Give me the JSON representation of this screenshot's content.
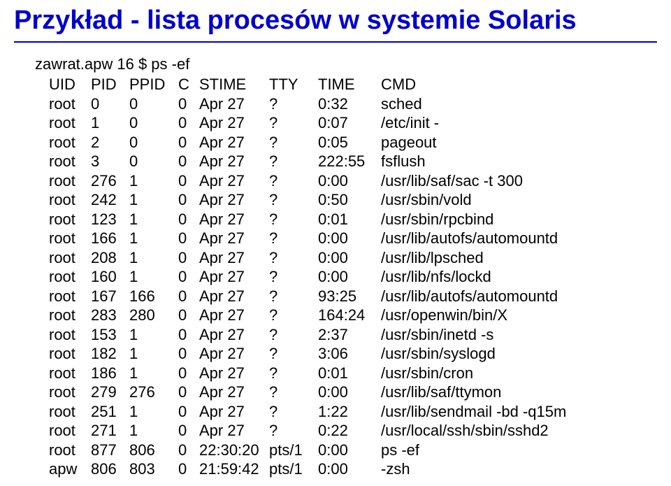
{
  "title": "Przykład - lista procesów w systemie Solaris",
  "prompt": "zawrat.apw 16 $ ps -ef",
  "headers": {
    "uid": "UID",
    "pid": "PID",
    "ppid": "PPID",
    "c": "C",
    "stime": "STIME",
    "tty": "TTY",
    "time": "TIME",
    "cmd": "CMD"
  },
  "rows": [
    {
      "uid": "root",
      "pid": "0",
      "ppid": "0",
      "c": "0",
      "stime": "Apr 27",
      "tty": "?",
      "time": "0:32",
      "cmd": "sched"
    },
    {
      "uid": "root",
      "pid": "1",
      "ppid": "0",
      "c": "0",
      "stime": "Apr 27",
      "tty": "?",
      "time": "0:07",
      "cmd": "/etc/init -"
    },
    {
      "uid": "root",
      "pid": "2",
      "ppid": "0",
      "c": "0",
      "stime": "Apr 27",
      "tty": "?",
      "time": "0:05",
      "cmd": "pageout"
    },
    {
      "uid": "root",
      "pid": "3",
      "ppid": "0",
      "c": "0",
      "stime": "Apr 27",
      "tty": "?",
      "time": "222:55",
      "cmd": "fsflush"
    },
    {
      "uid": "root",
      "pid": "276",
      "ppid": "1",
      "c": "0",
      "stime": "Apr 27",
      "tty": "?",
      "time": "0:00",
      "cmd": "/usr/lib/saf/sac -t 300"
    },
    {
      "uid": "root",
      "pid": "242",
      "ppid": "1",
      "c": "0",
      "stime": "Apr 27",
      "tty": "?",
      "time": "0:50",
      "cmd": "/usr/sbin/vold"
    },
    {
      "uid": "root",
      "pid": "123",
      "ppid": "1",
      "c": "0",
      "stime": "Apr 27",
      "tty": "?",
      "time": "0:01",
      "cmd": "/usr/sbin/rpcbind"
    },
    {
      "uid": "root",
      "pid": "166",
      "ppid": "1",
      "c": "0",
      "stime": "Apr 27",
      "tty": "?",
      "time": "0:00",
      "cmd": "/usr/lib/autofs/automountd"
    },
    {
      "uid": "root",
      "pid": "208",
      "ppid": "1",
      "c": "0",
      "stime": "Apr 27",
      "tty": "?",
      "time": "0:00",
      "cmd": "/usr/lib/lpsched"
    },
    {
      "uid": "root",
      "pid": "160",
      "ppid": "1",
      "c": "0",
      "stime": "Apr 27",
      "tty": "?",
      "time": "0:00",
      "cmd": "/usr/lib/nfs/lockd"
    },
    {
      "uid": "root",
      "pid": "167",
      "ppid": "166",
      "c": "0",
      "stime": "Apr 27",
      "tty": "?",
      "time": "93:25",
      "cmd": "/usr/lib/autofs/automountd"
    },
    {
      "uid": "root",
      "pid": "283",
      "ppid": "280",
      "c": "0",
      "stime": "Apr 27",
      "tty": "?",
      "time": "164:24",
      "cmd": "/usr/openwin/bin/X"
    },
    {
      "uid": "root",
      "pid": "153",
      "ppid": "1",
      "c": "0",
      "stime": "Apr 27",
      "tty": "?",
      "time": "2:37",
      "cmd": "/usr/sbin/inetd -s"
    },
    {
      "uid": "root",
      "pid": "182",
      "ppid": "1",
      "c": "0",
      "stime": "Apr 27",
      "tty": "?",
      "time": "3:06",
      "cmd": "/usr/sbin/syslogd"
    },
    {
      "uid": "root",
      "pid": "186",
      "ppid": "1",
      "c": "0",
      "stime": "Apr 27",
      "tty": "?",
      "time": "0:01",
      "cmd": "/usr/sbin/cron"
    },
    {
      "uid": "root",
      "pid": "279",
      "ppid": "276",
      "c": "0",
      "stime": "Apr 27",
      "tty": "?",
      "time": "0:00",
      "cmd": " /usr/lib/saf/ttymon"
    },
    {
      "uid": "root",
      "pid": "251",
      "ppid": "1",
      "c": "0",
      "stime": "Apr 27",
      "tty": "?",
      "time": "1:22",
      "cmd": "/usr/lib/sendmail -bd -q15m"
    },
    {
      "uid": "root",
      "pid": "271",
      "ppid": "1",
      "c": "0",
      "stime": "Apr 27",
      "tty": "?",
      "time": "0:22",
      "cmd": "/usr/local/ssh/sbin/sshd2"
    },
    {
      "uid": "root",
      "pid": "877",
      "ppid": "806",
      "c": "0",
      "stime": "22:30:20",
      "tty": "pts/1",
      "time": "0:00",
      "cmd": "ps -ef"
    },
    {
      "uid": "apw",
      "pid": "806",
      "ppid": "803",
      "c": "0",
      "stime": "21:59:42",
      "tty": "pts/1",
      "time": "0:00",
      "cmd": "-zsh"
    }
  ]
}
